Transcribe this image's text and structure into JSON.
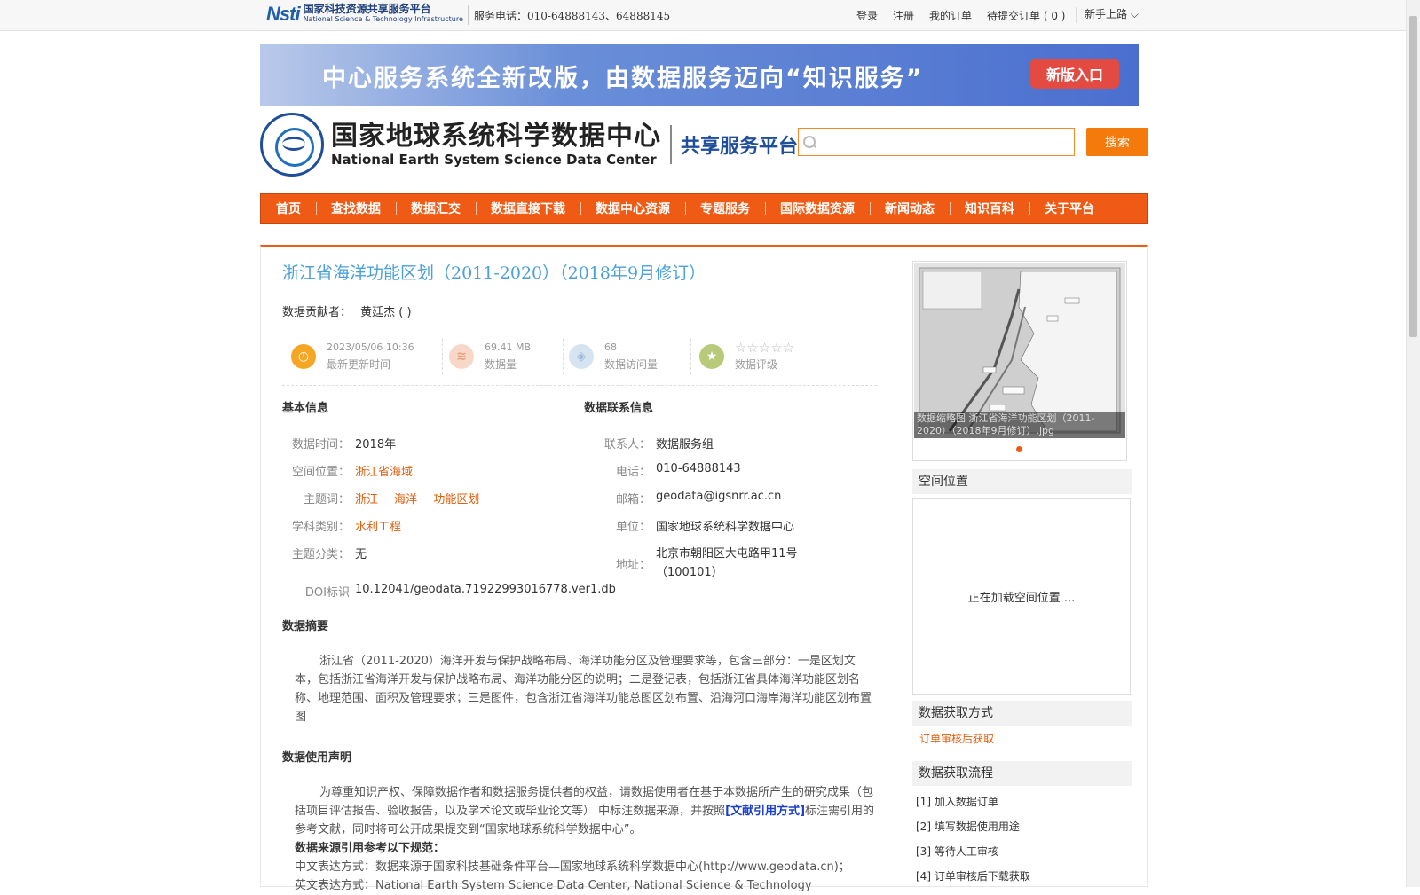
{
  "topbar": {
    "logo_cn": "国家科技资源共享服务平台",
    "logo_en": "National Science & Technology Infrastructure",
    "logo_mark": "Nsti",
    "phone": "服务电话：010-64888143、64888145",
    "links": [
      "登录",
      "注册",
      "我的订单",
      "待提交订单 ( 0 )"
    ],
    "guide": "新手上路 ⌵"
  },
  "banner": {
    "text": "中心服务系统全新改版，由数据服务迈向“知识服务”",
    "button": "新版入口"
  },
  "header": {
    "logo_cn": "国家地球系统科学数据中心",
    "logo_en": "National Earth System Science Data Center",
    "platform": "共享服务平台",
    "search_placeholder": "",
    "search_button": "搜索"
  },
  "nav": [
    "首页",
    "查找数据",
    "数据汇交",
    "数据直接下载",
    "数据中心资源",
    "专题服务",
    "国际数据资源",
    "新闻动态",
    "知识百科",
    "关于平台"
  ],
  "dataset": {
    "title": "浙江省海洋功能区划（2011-2020）（2018年9月修订）",
    "contributor_label": "数据贡献者：",
    "contributor": "黄廷杰 ( )",
    "stats": [
      {
        "value": "2023/05/06 10:36",
        "label": "最新更新时间"
      },
      {
        "value": "69.41 MB",
        "label": "数据量"
      },
      {
        "value": "68",
        "label": "数据访问量"
      },
      {
        "value": "☆☆☆☆☆",
        "label": "数据评级"
      }
    ],
    "basic_heading": "基本信息",
    "contact_heading": "数据联系信息",
    "basic": {
      "time_label": "数据时间：",
      "time": "2018年",
      "space_label": "空间位置：",
      "space": "浙江省海域",
      "keywords_label": "主题词：",
      "keywords": [
        "浙江",
        "海洋",
        "功能区划"
      ],
      "discipline_label": "学科类别：",
      "discipline": "水利工程",
      "theme_label": "主题分类：",
      "theme": "无",
      "doi_label": "DOI标识",
      "doi": "10.12041/geodata.71922993016778.ver1.db"
    },
    "contact": {
      "person_label": "联系人：",
      "person": "数据服务组",
      "phone_label": "电话：",
      "phone": "010-64888143",
      "email_label": "邮箱：",
      "email": "geodata@igsnrr.ac.cn",
      "unit_label": "单位：",
      "unit": "国家地球系统科学数据中心",
      "address_label": "地址：",
      "address_line1": "北京市朝阳区大屯路甲11号",
      "address_line2": "（100101）"
    },
    "abstract_heading": "数据摘要",
    "abstract": "浙江省（2011-2020）海洋开发与保护战略布局、海洋功能分区及管理要求等，包含三部分：一是区划文本，包括浙江省海洋开发与保护战略布局、海洋功能分区的说明；二是登记表，包括浙江省具体海洋功能区划名称、地理范围、面积及管理要求；三是图件，包含浙江省海洋功能总图区划布置、沿海河口海岸海洋功能区划布置图",
    "usage_heading": "数据使用声明",
    "usage_p1_a": "为尊重知识产权、保障数据作者和数据服务提供者的权益，请数据使用者在基于本数据所产生的研究成果（包括项目评估报告、验收报告，以及学术论文或毕业论文等） 中标注数据来源，并按照",
    "usage_p1_link": "[文献引用方式]",
    "usage_p1_b": "标注需引用的参考文献，同时将可公开成果提交到“国家地球系统科学数据中心”。",
    "usage_rule": "数据来源引用参考以下规范：",
    "usage_cn": "中文表达方式：数据来源于国家科技基础条件平台—国家地球系统科学数据中心(http://www.geodata.cn)；",
    "usage_en": "英文表达方式：National Earth System Science Data Center, National Science & Technology"
  },
  "sidebar": {
    "thumb_caption": "数据缩略图 浙江省海洋功能区划（2011-2020）（2018年9月修订）.jpg",
    "space_heading": "空间位置",
    "map_loading": "正在加载空间位置 ...",
    "access_heading": "数据获取方式",
    "access_value": "订单审核后获取",
    "process_heading": "数据获取流程",
    "steps": [
      "[1] 加入数据订单",
      "[2] 填写数据使用用途",
      "[3] 等待人工审核",
      "[4] 订单审核后下载获取"
    ]
  }
}
